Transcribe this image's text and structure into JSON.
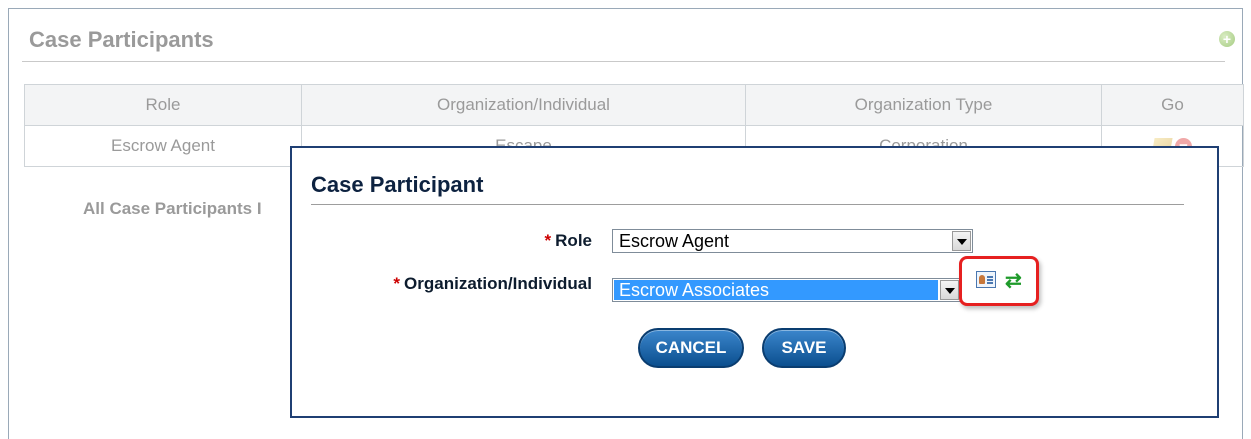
{
  "panel": {
    "title": "Case Participants",
    "add_icon": "plus-circle-icon",
    "table": {
      "headers": [
        "Role",
        "Organization/Individual",
        "Organization Type",
        "Go"
      ],
      "rows": [
        {
          "role": "Escrow Agent",
          "organization": "Escape",
          "organization_type": "Corporation"
        }
      ]
    },
    "all_participants_label": "All Case Participants I"
  },
  "modal": {
    "title": "Case Participant",
    "role": {
      "required_mark": "*",
      "label": "Role",
      "value": "Escrow Agent"
    },
    "organization": {
      "required_mark": "*",
      "label": "Organization/Individual",
      "value": "Escrow Associates"
    },
    "icons": [
      "contact-card-icon",
      "refresh-icon"
    ],
    "cancel_label": "CANCEL",
    "save_label": "SAVE"
  },
  "colors": {
    "accent": "#0b4f8f",
    "highlight_border": "#e62020",
    "selection": "#3399ff",
    "required": "#cc0000"
  }
}
